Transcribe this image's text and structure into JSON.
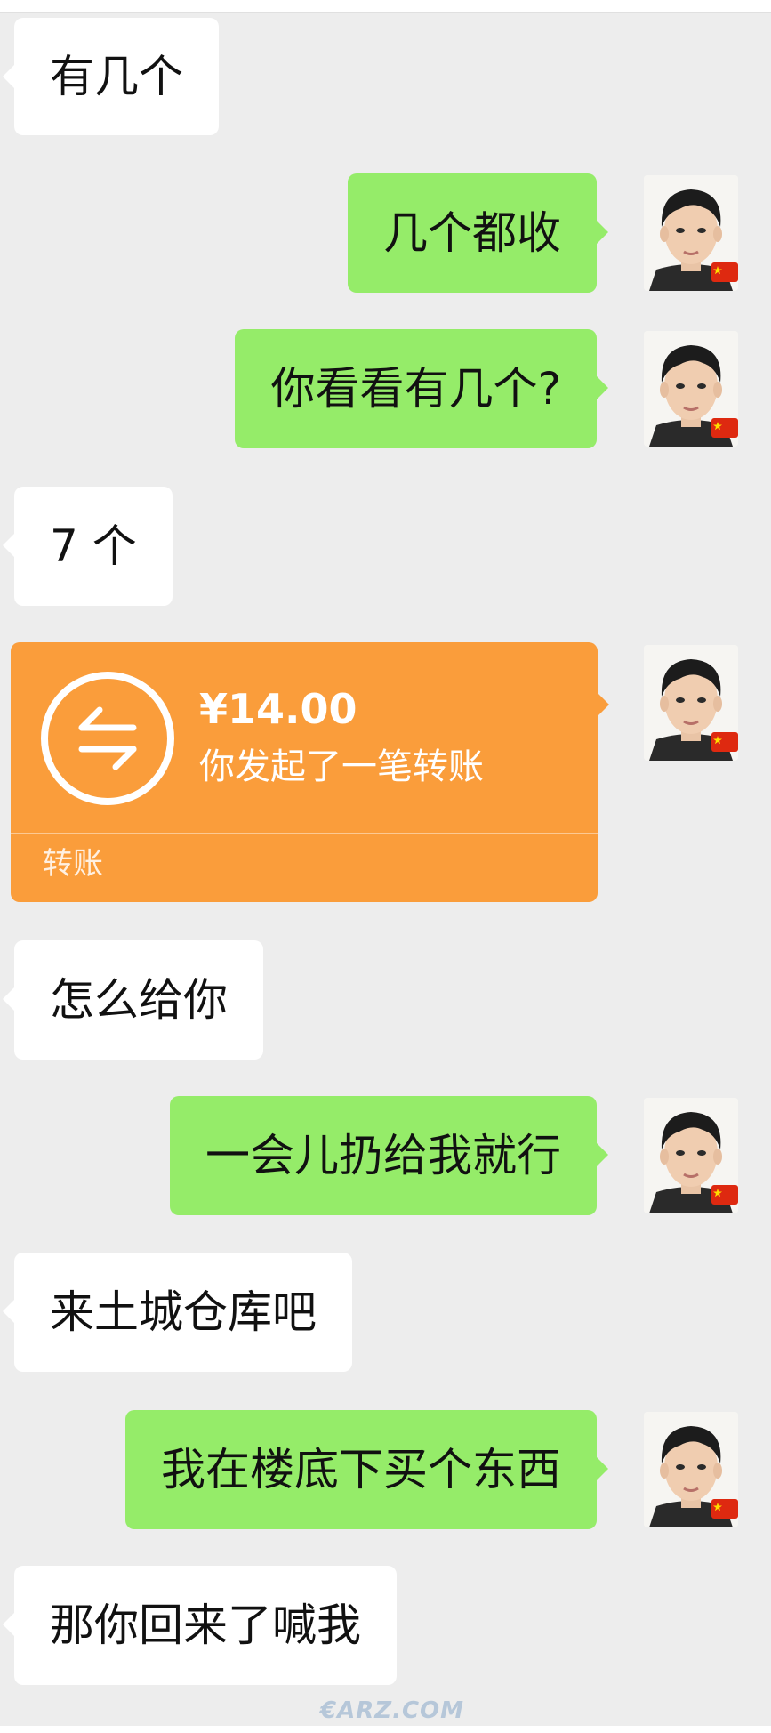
{
  "messages": {
    "m1": "有几个",
    "m2": "几个都收",
    "m3": "你看看有几个?",
    "m4": "7 个",
    "m6": "怎么给你",
    "m7": "一会儿扔给我就行",
    "m8": "来土城仓库吧",
    "m9": "我在楼底下买个东西",
    "m10": "那你回来了喊我"
  },
  "transfer": {
    "amount": "¥14.00",
    "description": "你发起了一笔转账",
    "label": "转账"
  },
  "watermark": "€ARZ.COM",
  "icons": {
    "transfer": "transfer-arrows-icon",
    "avatar": "user-avatar",
    "flag": "china-flag-icon"
  },
  "colors": {
    "background": "#ededed",
    "left_bubble": "#ffffff",
    "right_bubble": "#95ec69",
    "transfer_card": "#fa9d3b"
  }
}
